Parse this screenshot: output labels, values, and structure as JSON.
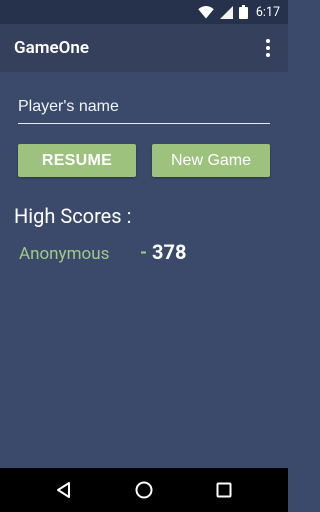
{
  "status_bar": {
    "time": "6:17"
  },
  "app_bar": {
    "title": "GameOne"
  },
  "form": {
    "name_placeholder": "Player's name",
    "name_value": ""
  },
  "buttons": {
    "resume": "RESUME",
    "new_game": "New Game"
  },
  "high_scores": {
    "title": "High Scores :",
    "entries": [
      {
        "name": "Anonymous",
        "separator": "-",
        "score": "378"
      }
    ]
  },
  "colors": {
    "background": "#3B4A6B",
    "app_bar": "#34405C",
    "status_bar": "#26324B",
    "button": "#9CC27E",
    "accent_text": "#A3C98A"
  }
}
